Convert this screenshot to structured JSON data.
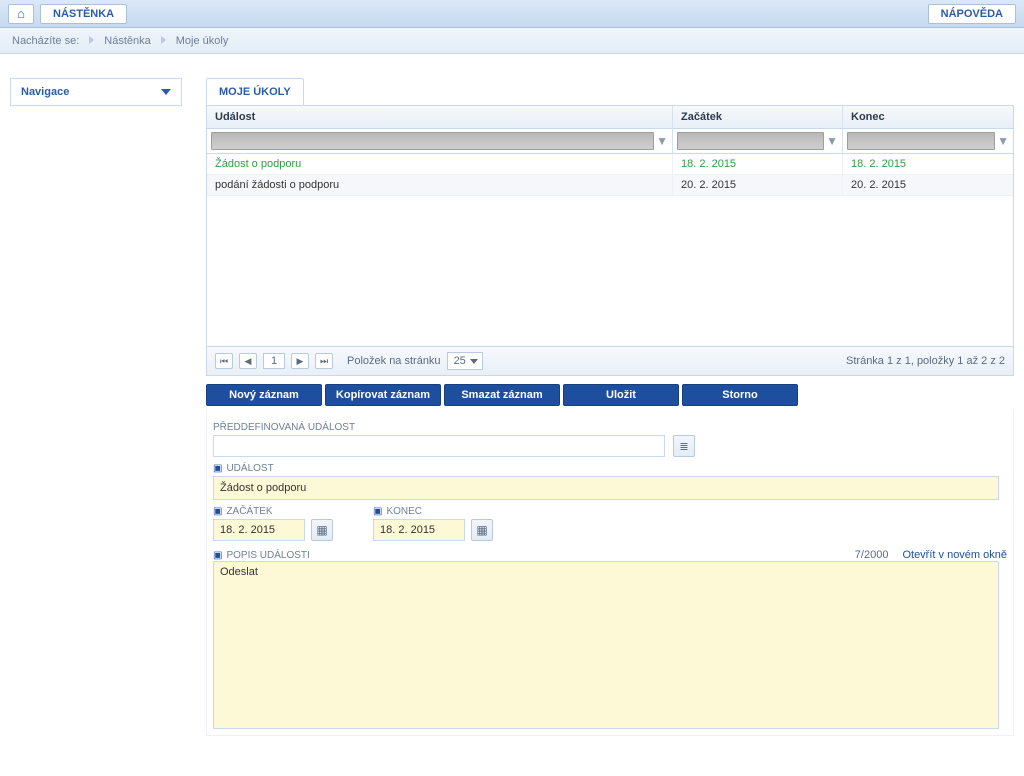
{
  "topbar": {
    "nastenka": "NÁSTĚNKA",
    "napoveda": "NÁPOVĚDA"
  },
  "breadcrumb": {
    "label": "Nacházíte se:",
    "items": [
      "Nástěnka",
      "Moje úkoly"
    ]
  },
  "nav_panel": {
    "title": "Navigace"
  },
  "tab": {
    "title": "MOJE ÚKOLY"
  },
  "table": {
    "headers": {
      "event": "Událost",
      "start": "Začátek",
      "end": "Konec"
    },
    "rows": [
      {
        "event": "Žádost o podporu",
        "start": "18. 2. 2015",
        "end": "18. 2. 2015",
        "selected": true
      },
      {
        "event": "podání žádosti o podporu",
        "start": "20. 2. 2015",
        "end": "20. 2. 2015",
        "selected": false
      }
    ]
  },
  "pager": {
    "page": "1",
    "per_page_label": "Položek na stránku",
    "per_page_value": "25",
    "status": "Stránka 1 z 1, položky 1 až 2 z 2"
  },
  "actions": {
    "novy": "Nový záznam",
    "kopirovat": "Kopírovat záznam",
    "smazat": "Smazat záznam",
    "ulozit": "Uložit",
    "storno": "Storno"
  },
  "form": {
    "predef_label": "PŘEDDEFINOVANÁ UDÁLOST",
    "udalost_label": "UDÁLOST",
    "udalost_value": "Žádost o podporu",
    "zacatek_label": "ZAČÁTEK",
    "zacatek_value": "18. 2. 2015",
    "konec_label": "KONEC",
    "konec_value": "18. 2. 2015",
    "popis_label": "POPIS UDÁLOSTI",
    "popis_value": "Odeslat",
    "counter": "7/2000",
    "open_new": "Otevřít v novém okně",
    "req_glyph": "▣"
  }
}
